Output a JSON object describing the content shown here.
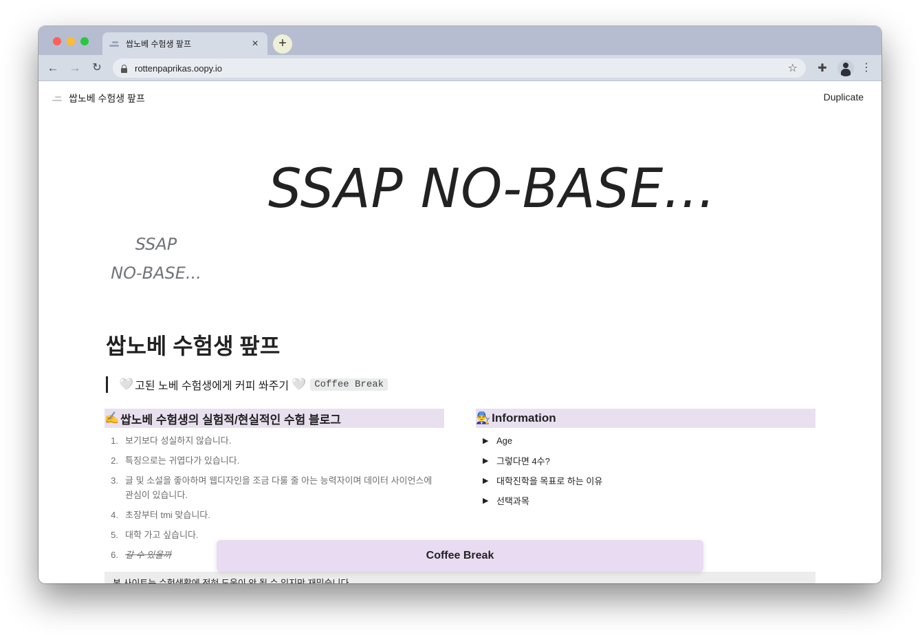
{
  "browser": {
    "tab_title": "쌉노베 수험생 팦프",
    "tab_close": "×",
    "new_tab": "+",
    "url": "rottenpaprikas.oopy.io",
    "back": "←",
    "forward": "→",
    "reload": "↻",
    "star": "☆",
    "menu": "⋮",
    "ext": "✚"
  },
  "topbar": {
    "site_title": "쌉노베 수험생 팦프",
    "duplicate_label": "Duplicate"
  },
  "banner": {
    "text": "SSAP NO-BASE...",
    "small_line1": "SSAP",
    "small_line2": "NO-BASE..."
  },
  "page": {
    "title": "쌉노베 수험생 팦프",
    "quote_heart": "🤍",
    "quote_text": "고된 노베 수험생에게 커피 쏴주기",
    "quote_code": "Coffee Break"
  },
  "left_column": {
    "icon": "✍️",
    "header": "쌉노베 수험생의 실험적/현실적인 수험 블로그",
    "items": [
      {
        "num": "1.",
        "text": "보기보다 성실하지 않습니다."
      },
      {
        "num": "2.",
        "text": "특징으로는 귀엽다가 있습니다."
      },
      {
        "num": "3.",
        "text": "글 및 소설을 좋아하며 웹디자인을 조금 다룰 줄 아는 능력자이며 데이터 사이언스에 관심이 있습니다."
      },
      {
        "num": "4.",
        "text": "초장부터 tmi 맞습니다."
      },
      {
        "num": "5.",
        "text": "대학 가고 싶습니다."
      },
      {
        "num": "6.",
        "text": "갈 수 있을까"
      }
    ]
  },
  "right_column": {
    "icon": "👨‍🔧",
    "header": "Information",
    "toggle_arrow": "▶",
    "toggles": [
      "Age",
      "그렇다면 4수?",
      "대학진학을 목표로 하는 이유",
      "선택과목"
    ]
  },
  "note": {
    "text": "- 본 사이트는 수험생활에 전혀 도움이 안 될 수 있지만 재밌습니다."
  },
  "coffee_button": {
    "label": "Coffee Break"
  }
}
